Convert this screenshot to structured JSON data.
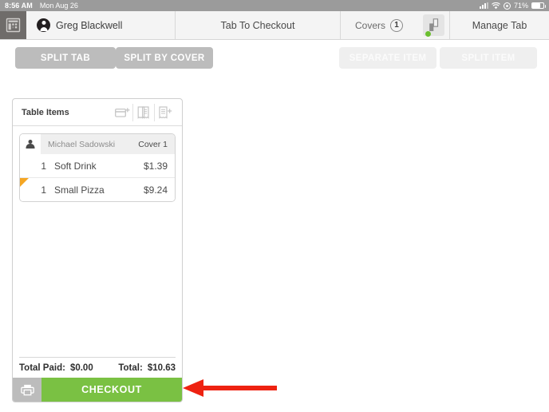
{
  "status_bar": {
    "time": "8:56 AM",
    "date": "Mon Aug 26",
    "battery_percent": "71%",
    "icons": [
      "cellular-signal-icon",
      "wifi-icon",
      "rotation-lock-icon",
      "battery-icon"
    ]
  },
  "header": {
    "app_icon": "register-icon",
    "user_name": "Greg Blackwell",
    "title": "Tab To Checkout",
    "covers_label": "Covers",
    "covers_count": "1",
    "seat_toggle_icon": "seat-split-icon",
    "seat_status": "online",
    "manage_tab_label": "Manage Tab"
  },
  "toolbar": {
    "split_tab_label": "SPLIT TAB",
    "split_by_cover_label": "SPLIT BY COVER",
    "separate_item_label": "SEPARATE ITEM",
    "split_item_label": "SPLIT ITEM"
  },
  "panel": {
    "title": "Table Items",
    "icons": [
      "add-tab-icon",
      "move-items-icon",
      "add-receipt-icon"
    ],
    "cover": {
      "guest_name": "Michael Sadowski",
      "cover_label": "Cover 1"
    },
    "items": [
      {
        "qty": "1",
        "name": "Soft Drink",
        "price": "$1.39",
        "flagged": false
      },
      {
        "qty": "1",
        "name": "Small Pizza",
        "price": "$9.24",
        "flagged": true
      }
    ],
    "totals": {
      "paid_label": "Total Paid:",
      "paid_value": "$0.00",
      "total_label": "Total:",
      "total_value": "$10.63"
    },
    "print_icon": "printer-icon",
    "checkout_label": "CHECKOUT"
  },
  "annotation": {
    "arrow": "left-pointing-arrow",
    "color": "#ee2211",
    "points_at": "checkout-button"
  },
  "colors": {
    "accent_green": "#7ac143",
    "button_grey": "#bcbcbc",
    "button_disabled": "#efefef",
    "flag_orange": "#f5a623",
    "status_bar": "#9b9b9b"
  }
}
